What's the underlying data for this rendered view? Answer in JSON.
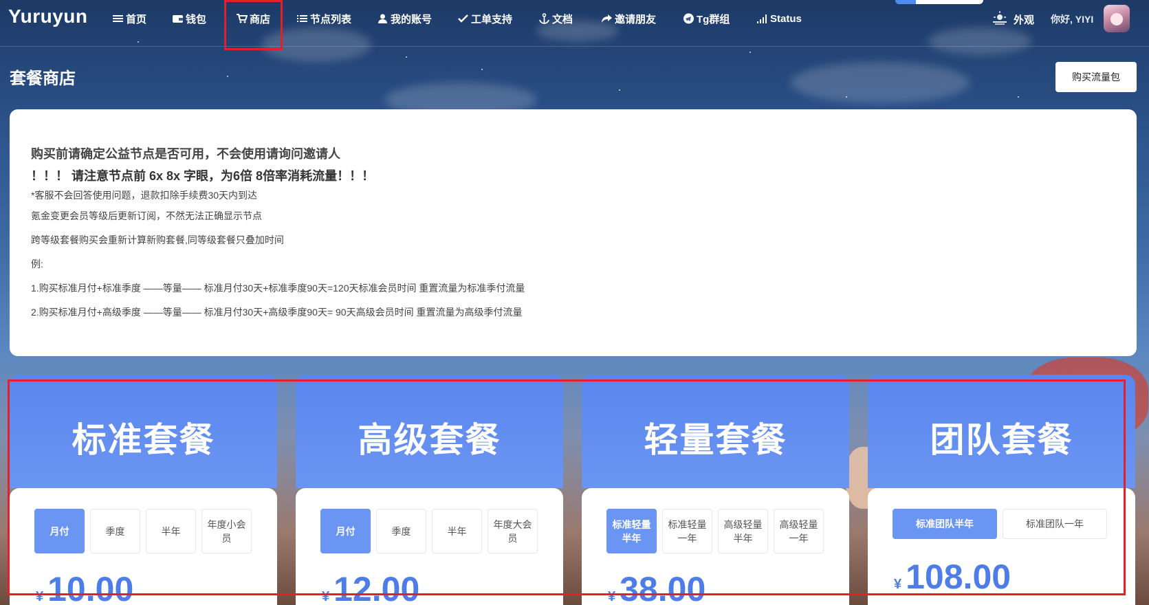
{
  "brand": "Yuruyun",
  "nav": [
    {
      "label": "首页",
      "icon": "menu-icon"
    },
    {
      "label": "钱包",
      "icon": "wallet-icon"
    },
    {
      "label": "商店",
      "icon": "cart-icon"
    },
    {
      "label": "节点列表",
      "icon": "list-icon"
    },
    {
      "label": "我的账号",
      "icon": "user-icon"
    },
    {
      "label": "工单支持",
      "icon": "check-icon"
    },
    {
      "label": "文档",
      "icon": "anchor-icon"
    },
    {
      "label": "邀请朋友",
      "icon": "share-icon"
    },
    {
      "label": "Tg群组",
      "icon": "telegram-icon"
    },
    {
      "label": "Status",
      "icon": "signal-icon"
    }
  ],
  "header_right": {
    "appearance_label": "外观",
    "greeting": "你好, YIYI"
  },
  "page": {
    "title": "套餐商店",
    "buy_traffic_button": "购买流量包"
  },
  "notice": {
    "line1": "购买前请确定公益节点是否可用，不会使用请询问邀请人",
    "line2": "！！！ 请注意节点前 6x 8x 字眼，为6倍 8倍率消耗流量！！！",
    "line3": "*客服不会回答使用问题，退款扣除手续费30天内到达",
    "line4": "氪金变更会员等级后更新订阅，不然无法正确显示节点",
    "line5": "跨等级套餐购买会重新计算新购套餐,同等级套餐只叠加时间",
    "line6": "例:",
    "line7": "1.购买标准月付+标准季度 ——等量—— 标准月付30天+标准季度90天=120天标准会员时间 重置流量为标准季付流量",
    "line8": "2.购买标准月付+高级季度 ——等量—— 标准月付30天+高级季度90天= 90天高级会员时间 重置流量为高级季付流量"
  },
  "plans": [
    {
      "name": "标准套餐",
      "tabs": [
        "月付",
        "季度",
        "半年",
        "年度小会员"
      ],
      "active_tab": 0,
      "currency": "¥",
      "price": "10.00"
    },
    {
      "name": "高级套餐",
      "tabs": [
        "月付",
        "季度",
        "半年",
        "年度大会员"
      ],
      "active_tab": 0,
      "currency": "¥",
      "price": "12.00"
    },
    {
      "name": "轻量套餐",
      "tabs": [
        "标准轻量半年",
        "标准轻量一年",
        "高级轻量半年",
        "高级轻量一年"
      ],
      "active_tab": 0,
      "currency": "¥",
      "price": "38.00"
    },
    {
      "name": "团队套餐",
      "tabs": [
        "标准团队半年",
        "标准团队一年"
      ],
      "active_tab": 0,
      "currency": "¥",
      "price": "108.00"
    }
  ],
  "colors": {
    "accent": "#6b95f2",
    "price": "#4e7de8",
    "highlight_box": "#e2202a"
  }
}
